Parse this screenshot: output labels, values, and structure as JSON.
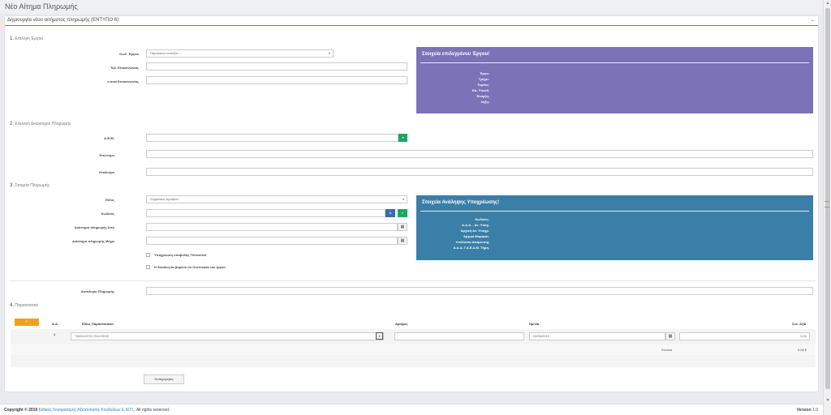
{
  "page": {
    "title": "Νέο Αίτημα Πληρωμής"
  },
  "panel": {
    "heading": "Δημιουργία νέου αιτήματος πληρωμής (ΕΝΤΥΠΟ 6)",
    "collapse_icon": "←"
  },
  "section1": {
    "number": "1.",
    "title": "Επιλογή Έργου",
    "project_code_label": "Κωδ. Έργου",
    "project_code_placeholder": "Παρακαλώ επιλέξτε ...",
    "phone_label": "Τηλ. Επικοινωνίας",
    "email_label": "e-mail Επικοινωνίας",
    "info_box": {
      "title": "Στοιχεία επιλεγμένου Έργου!",
      "fields": [
        "Έργο:",
        "Τρέχει:",
        "Τομέας:",
        "Επ. Υπεύθ.",
        "Έναρξη:",
        "Λήξη:"
      ],
      "color": "#7b72b8"
    }
  },
  "section2": {
    "number": "2.",
    "title": "Επιλογή Δικαιούχου Πληρωμής",
    "afm_label": "Α.Φ.Μ.",
    "afm_button_icon": "▾",
    "surname_label": "Επώνυμο",
    "firstname_label": "Επιθετ/μο"
  },
  "section3": {
    "number": "3.",
    "title": "Στοιχεία Πληρωμής",
    "type_label": "Είδος",
    "type_value": "Σύμβασεις Αμοιβών",
    "code_label": "Κωδικός",
    "code_buttons": [
      "$",
      "⌕"
    ],
    "period_from_label": "Διάστημα πληρωμής Από",
    "period_to_label": "Διάστημα πληρωμής Μέχρι",
    "calendar_icon": "▦",
    "timesheet_label": "Υποχρέωση υποβολής Timesheet",
    "overheads_label": "Η δαπάνη θα βαρύνει τα Overheads του έργου",
    "info_box": {
      "title": "Στοιχεία Ανάληψης Υποχρέωσης!",
      "fields": [
        "Κωδικός:",
        "Α.Α.Α. - Αν. Υποχ.",
        "Αρχική Αν. Υποχρ.",
        "Αρχικό Μορφοπ.",
        "Υπόλοιπο Δέσμευσης",
        "Α.Α.Α. Γ.Α.Ε.Α.Μ. Τήρη."
      ],
      "color": "#3a7fa8"
    },
    "justification_label": "Αιτιολογία Πληρωμής"
  },
  "section4": {
    "number": "4.",
    "title": "Παραστατικά",
    "add_icon": "+",
    "columns": [
      "Α.Α.",
      "Είδος Παραστατικού",
      "Αριθμός",
      "Ημ/νία",
      "Συν. Αξία"
    ],
    "rows": [
      {
        "aa": "1",
        "type": "ΤΙΜΟΛΟΓΙΟ ΠΩΛΗΣΗΣ",
        "number": "",
        "date": "02/05/2019",
        "value": "0,00"
      }
    ],
    "total_label": "Σύνολα",
    "total_value": "0,00 €"
  },
  "submit_label": "Καταχώρηση",
  "footer": {
    "copyright_prefix": "Copyright © 2019",
    "company": "Ειδικός Λογαριασμός Αξιοποίησης Κονδυλίων Ε.Μ.Π.",
    "rights": ", All rights reserved.",
    "version_label": "Version",
    "version_value": "1.0"
  },
  "scrollbar": {
    "up_icon": "▲",
    "down_icon": "▼"
  }
}
